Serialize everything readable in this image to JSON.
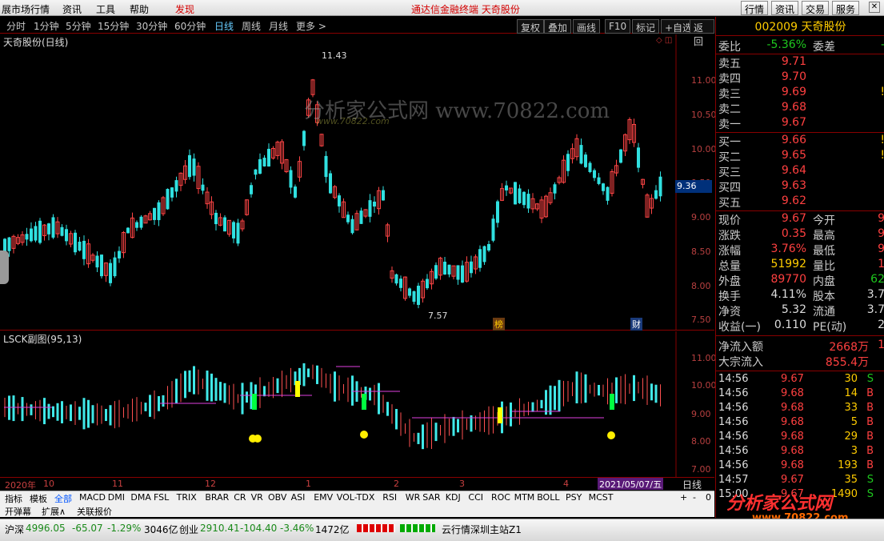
{
  "app": {
    "title": "展市场行情",
    "menus": [
      "资讯",
      "工具",
      "帮助",
      "发现"
    ],
    "center_title": "通达信金融终端   天奇股份"
  },
  "top_buttons": [
    "行情",
    "资讯",
    "交易",
    "服务"
  ],
  "period_tabs": [
    "分时",
    "1分钟",
    "5分钟",
    "15分钟",
    "30分钟",
    "60分钟",
    "日线",
    "周线",
    "月线",
    "更多 >"
  ],
  "period_active": "日线",
  "right_tools": [
    "复权",
    "叠加",
    "画线",
    "F10",
    "标记",
    "+自选",
    "返回"
  ],
  "main_chart": {
    "title": "天奇股份(日线)",
    "high_label": "11.43",
    "low_label": "7.57",
    "cursor_price": "9.36",
    "tags": [
      "榜",
      "财"
    ],
    "yticks": [
      "11.00",
      "10.50",
      "10.00",
      "9.50",
      "9.00",
      "8.50",
      "8.00",
      "7.50"
    ]
  },
  "sub_chart": {
    "title": "LSCK副图(95,13)",
    "yticks": [
      "11.00",
      "10.00",
      "9.00",
      "8.00",
      "7.00"
    ]
  },
  "time_axis": {
    "labels": [
      "2020年",
      "10",
      "11",
      "12",
      "1",
      "2",
      "3",
      "4"
    ],
    "date": "2021/05/07/五",
    "period": "日线"
  },
  "indicator_tabs": [
    "指标",
    "模板",
    "全部",
    "MACD",
    "DMI",
    "DMA",
    "FSL",
    "TRIX",
    "BRAR",
    "CR",
    "VR",
    "OBV",
    "ASI",
    "EMV",
    "VOL-TDX",
    "RSI",
    "WR",
    "SAR",
    "KDJ",
    "CCI",
    "ROC",
    "MTM",
    "BOLL",
    "PSY",
    "MCST"
  ],
  "indicator_active": "全部",
  "indicator_controls": [
    "+",
    "-",
    "0"
  ],
  "ext_tabs": [
    "开弹幕",
    "扩展∧",
    "关联报价"
  ],
  "status": {
    "sh_name": "沪深",
    "sh_val": "4996.05",
    "sh_chg": "-65.07",
    "sh_pct": "-1.29%",
    "sh_amt": "3046亿",
    "cy_name": "创业",
    "cy_val": "2910.41",
    "cy_chg": "-104.40",
    "cy_pct": "-3.46%",
    "cy_amt": "1472亿",
    "server": "云行情深圳主站Z1"
  },
  "quote": {
    "code_name": "002009 天奇股份",
    "weibi_label": "委比",
    "weibi": "-5.36%",
    "weicha_label": "委差",
    "weicha": "-",
    "asks": [
      {
        "l": "卖五",
        "p": "9.71",
        "v": ""
      },
      {
        "l": "卖四",
        "p": "9.70",
        "v": ""
      },
      {
        "l": "卖三",
        "p": "9.69",
        "v": "!"
      },
      {
        "l": "卖二",
        "p": "9.68",
        "v": ""
      },
      {
        "l": "卖一",
        "p": "9.67",
        "v": ""
      }
    ],
    "bids": [
      {
        "l": "买一",
        "p": "9.66",
        "v": "!"
      },
      {
        "l": "买二",
        "p": "9.65",
        "v": "!"
      },
      {
        "l": "买三",
        "p": "9.64",
        "v": ""
      },
      {
        "l": "买四",
        "p": "9.63",
        "v": ""
      },
      {
        "l": "买五",
        "p": "9.62",
        "v": ""
      }
    ],
    "stats": [
      {
        "a": "现价",
        "av": "9.67",
        "b": "今开",
        "bv": "9"
      },
      {
        "a": "涨跌",
        "av": "0.35",
        "b": "最高",
        "bv": "9"
      },
      {
        "a": "涨幅",
        "av": "3.76%",
        "b": "最低",
        "bv": "9"
      },
      {
        "a": "总量",
        "av": "51992",
        "b": "量比",
        "bv": "1"
      },
      {
        "a": "外盘",
        "av": "89770",
        "b": "内盘",
        "bv": "62"
      },
      {
        "a": "换手",
        "av": "4.11%",
        "b": "股本",
        "bv": "3.7"
      },
      {
        "a": "净资",
        "av": "5.32",
        "b": "流通",
        "bv": "3.7"
      },
      {
        "a": "收益(一)",
        "av": "0.110",
        "b": "PE(动)",
        "bv": "2"
      }
    ],
    "flows": [
      {
        "a": "净流入额",
        "av": "2668万",
        "bv": "1"
      },
      {
        "a": "大宗流入",
        "av": "855.4万",
        "bv": ""
      }
    ],
    "ticks": [
      {
        "t": "14:56",
        "p": "9.67",
        "q": "30",
        "s": "S"
      },
      {
        "t": "14:56",
        "p": "9.68",
        "q": "14",
        "s": "B"
      },
      {
        "t": "14:56",
        "p": "9.68",
        "q": "33",
        "s": "B"
      },
      {
        "t": "14:56",
        "p": "9.68",
        "q": "5",
        "s": "B"
      },
      {
        "t": "14:56",
        "p": "9.68",
        "q": "29",
        "s": "B"
      },
      {
        "t": "14:56",
        "p": "9.68",
        "q": "3",
        "s": "B"
      },
      {
        "t": "14:56",
        "p": "9.68",
        "q": "193",
        "s": "B"
      },
      {
        "t": "14:57",
        "p": "9.67",
        "q": "35",
        "s": "S"
      },
      {
        "t": "15:00",
        "p": "9.67",
        "q": "1490",
        "s": "S"
      }
    ]
  },
  "watermark": {
    "center": "分析家公式网 www.70822.com",
    "center_url": "www.70822.com",
    "corner": "分析家公式网",
    "corner_url": "www.70822.com"
  }
}
